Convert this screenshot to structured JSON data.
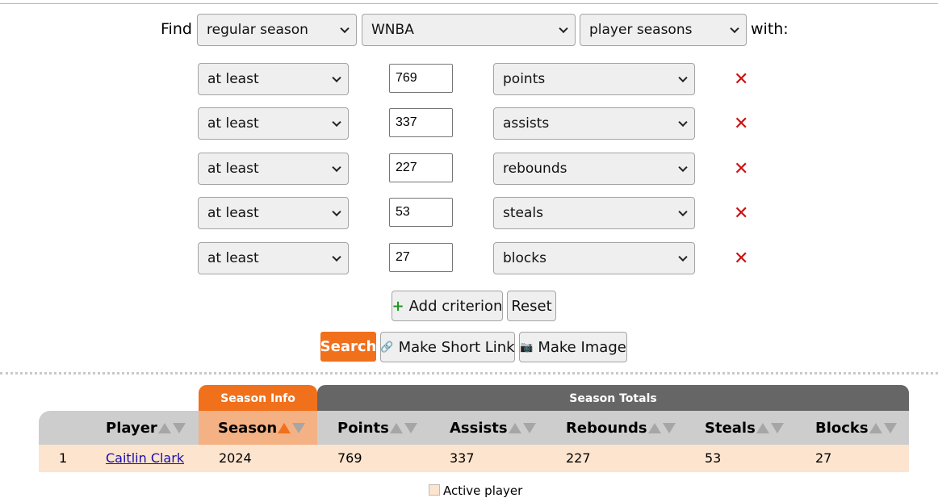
{
  "find": {
    "label_find": "Find",
    "label_with": "with:",
    "season_type": "regular season",
    "league": "WNBA",
    "mode": "player seasons"
  },
  "criteria": [
    {
      "comparison": "at least",
      "value": "769",
      "stat": "points"
    },
    {
      "comparison": "at least",
      "value": "337",
      "stat": "assists"
    },
    {
      "comparison": "at least",
      "value": "227",
      "stat": "rebounds"
    },
    {
      "comparison": "at least",
      "value": "53",
      "stat": "steals"
    },
    {
      "comparison": "at least",
      "value": "27",
      "stat": "blocks"
    }
  ],
  "remove_icon": "✕",
  "buttons": {
    "add_criterion": "Add criterion",
    "add_icon": "+",
    "reset": "Reset",
    "search": "Search",
    "short_link": "Make Short Link",
    "short_link_icon": "link-icon",
    "make_image": "Make Image",
    "make_image_icon": "camera-icon"
  },
  "table": {
    "groups": {
      "season_info": "Season Info",
      "season_totals": "Season Totals"
    },
    "columns": [
      "Player",
      "Season",
      "Points",
      "Assists",
      "Rebounds",
      "Steals",
      "Blocks"
    ],
    "rows": [
      {
        "rank": "1",
        "player": "Caitlin Clark",
        "season": "2024",
        "points": "769",
        "assists": "337",
        "rebounds": "227",
        "steals": "53",
        "blocks": "27"
      }
    ]
  },
  "legend": {
    "active_player": "Active player"
  },
  "colors": {
    "accent": "#f0701c",
    "row_highlight": "#fde4ce",
    "season_header": "#f4b183",
    "totals_header": "#666666",
    "remove": "#cc1111"
  }
}
